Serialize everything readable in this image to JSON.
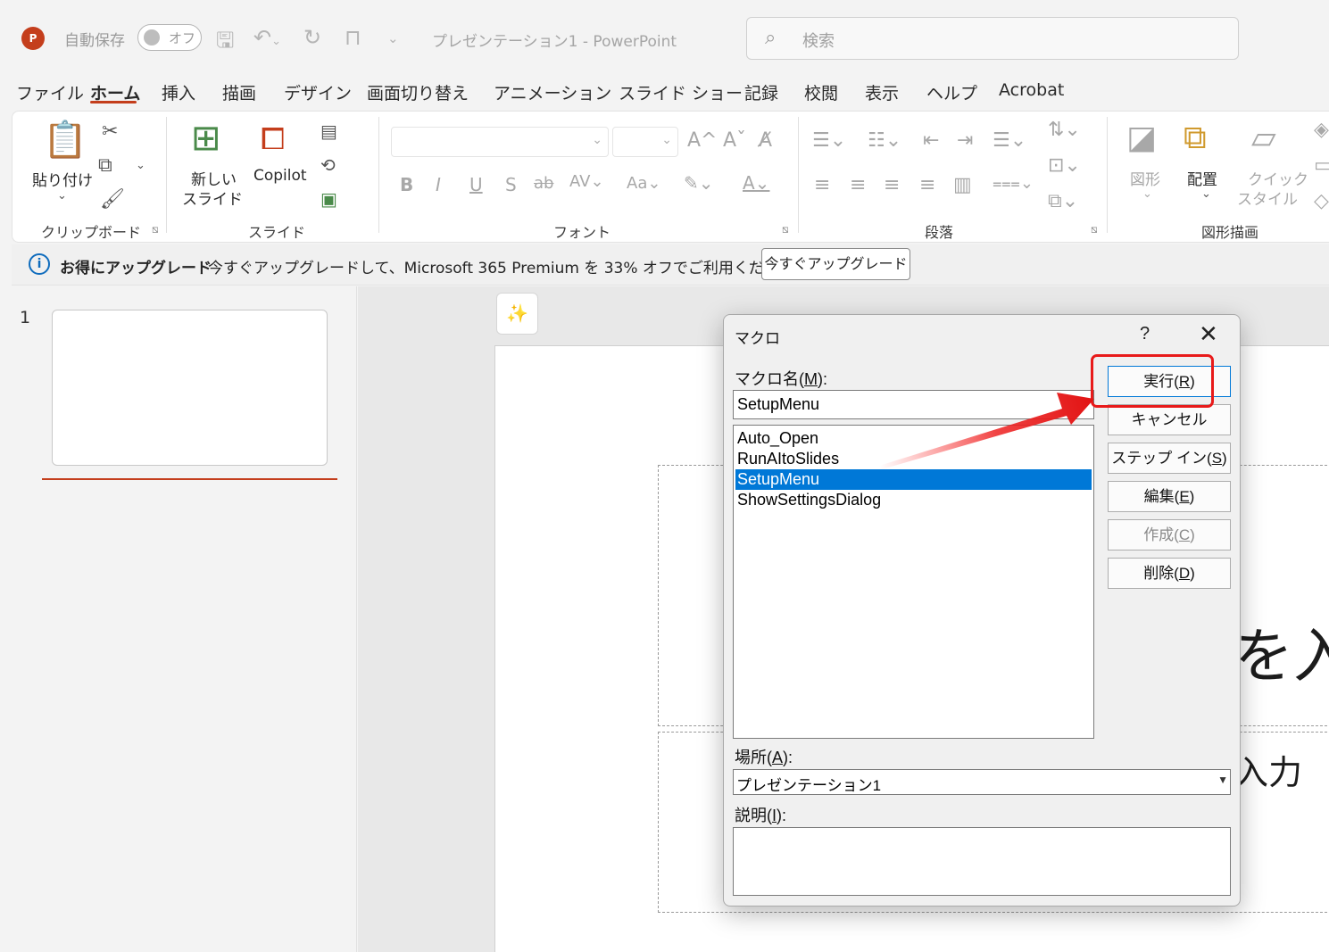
{
  "titlebar": {
    "app_icon_letter": "P",
    "autosave_label": "自動保存",
    "autosave_state": "オフ",
    "document_title": "プレゼンテーション1  -  PowerPoint",
    "search_placeholder": "検索",
    "qat_icons": [
      "save-icon",
      "undo-icon",
      "redo-icon",
      "present-icon",
      "customize-icon"
    ]
  },
  "tabs": [
    "ファイル",
    "ホーム",
    "挿入",
    "描画",
    "デザイン",
    "画面切り替え",
    "アニメーション",
    "スライド ショー",
    "記録",
    "校閲",
    "表示",
    "ヘルプ",
    "Acrobat"
  ],
  "active_tab": "ホーム",
  "ribbon": {
    "clipboard": {
      "label": "クリップボード",
      "paste": "貼り付け"
    },
    "slides": {
      "label": "スライド",
      "new_slide_line1": "新しい",
      "new_slide_line2": "スライド",
      "copilot": "Copilot"
    },
    "font": {
      "label": "フォント",
      "font_name": "",
      "font_size": ""
    },
    "paragraph": {
      "label": "段落"
    },
    "drawing": {
      "label": "図形描画",
      "shapes": "図形",
      "arrange": "配置",
      "quick_styles_line1": "クイック",
      "quick_styles_line2": "スタイル"
    }
  },
  "infobar": {
    "title": "お得にアップグレード",
    "message": "今すぐアップグレードして、Microsoft 365 Premium を 33% オフでご利用ください。",
    "button": "今すぐアップグレード"
  },
  "slide_pane": {
    "slide_number": "1"
  },
  "editor": {
    "title_placeholder_fragment": "を入",
    "subtitle_placeholder_fragment": "入力"
  },
  "macro_dialog": {
    "title": "マクロ",
    "help": "?",
    "macro_name_label": "マクロ名(",
    "macro_name_key": "M",
    "macro_name_suffix": "):",
    "macro_name_value": "SetupMenu",
    "macros": [
      "Auto_Open",
      "RunAItoSlides",
      "SetupMenu",
      "ShowSettingsDialog"
    ],
    "selected_macro": "SetupMenu",
    "buttons": {
      "run": {
        "label": "実行(",
        "key": "R"
      },
      "cancel": {
        "label": "キャンセル"
      },
      "step_in": {
        "label": "ステップ イン(",
        "key": "S"
      },
      "edit": {
        "label": "編集(",
        "key": "E"
      },
      "create": {
        "label": "作成(",
        "key": "C"
      },
      "delete": {
        "label": "削除(",
        "key": "D"
      }
    },
    "location_label": "場所(",
    "location_key": "A",
    "location_value": "プレゼンテーション1",
    "description_label": "説明(",
    "description_key": "I",
    "description_value": ""
  },
  "annotation": {
    "highlight_color": "#e81a1a"
  }
}
